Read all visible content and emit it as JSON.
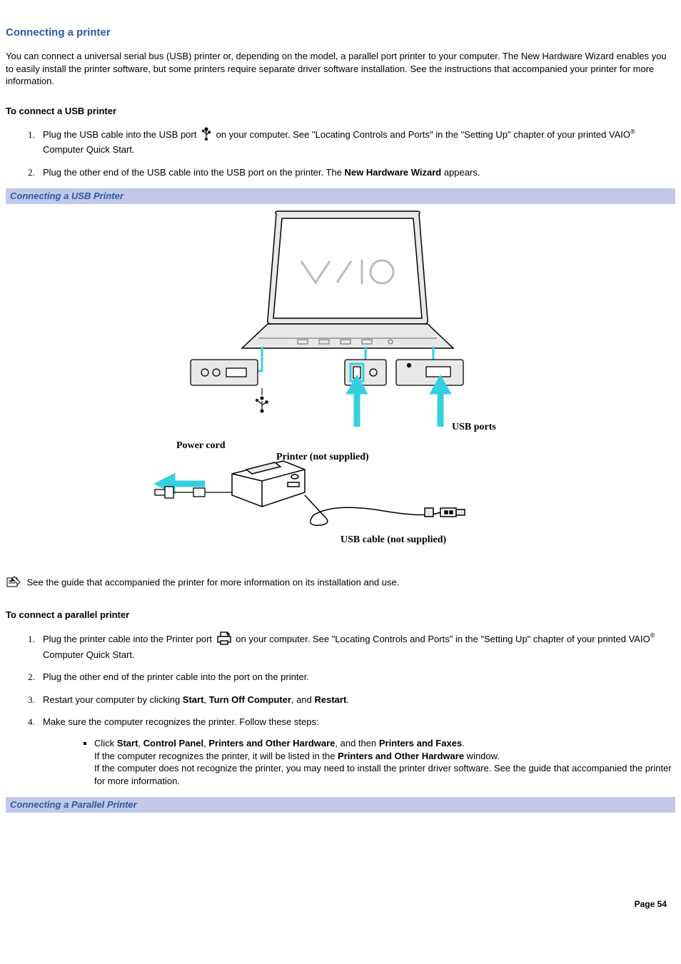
{
  "title": "Connecting a printer",
  "intro": "You can connect a universal serial bus (USB) printer or, depending on the model, a parallel port printer to your computer. The New Hardware Wizard enables you to easily install the printer software, but some printers require separate driver software installation. See the instructions that accompanied your printer for more information.",
  "usb": {
    "heading": "To connect a USB printer",
    "step1a": "Plug the USB cable into the USB port ",
    "step1b": " on your computer. See \"Locating Controls and Ports\" in the \"Setting Up\" chapter of your printed VAIO",
    "step1c": " Computer Quick Start.",
    "step2a": "Plug the other end of the USB cable into the USB port on the printer. The ",
    "step2bold": "New Hardware Wizard",
    "step2b": " appears."
  },
  "caption_usb": "Connecting a USB Printer",
  "figure": {
    "usb_ports": "USB ports",
    "power_cord": "Power cord",
    "printer_ns": "Printer (not supplied)",
    "usb_cable_ns": "USB cable (not supplied)"
  },
  "note_text": "See the guide that accompanied the printer for more information on its installation and use.",
  "parallel": {
    "heading": "To connect a parallel printer",
    "step1a": "Plug the printer cable into the Printer port ",
    "step1b": " on your computer. See \"Locating Controls and Ports\" in the \"Setting Up\" chapter of your printed VAIO",
    "step1c": " Computer Quick Start.",
    "step2": "Plug the other end of the printer cable into the port on the printer.",
    "step3a": "Restart your computer by clicking ",
    "step3_start": "Start",
    "step3_sep1": ", ",
    "step3_turnoff": "Turn Off Computer",
    "step3_sep2": ", and ",
    "step3_restart": "Restart",
    "step3b": ".",
    "step4": "Make sure the computer recognizes the printer. Follow these steps:",
    "bullet_a1": "Click ",
    "bullet_start": "Start",
    "bullet_s1": ", ",
    "bullet_cp": "Control Panel",
    "bullet_s2": ", ",
    "bullet_poh": "Printers and Other Hardware",
    "bullet_s3": ", and then ",
    "bullet_pf": "Printers and Faxes",
    "bullet_s4": ".",
    "bullet_line2a": "If the computer recognizes the printer, it will be listed in the ",
    "bullet_line2bold": "Printers and Other Hardware",
    "bullet_line2b": " window.",
    "bullet_line3": "If the computer does not recognize the printer, you may need to install the printer driver software. See the guide that accompanied the printer for more information."
  },
  "caption_parallel": "Connecting a Parallel Printer",
  "page_number": "Page 54",
  "reg_mark": "®"
}
